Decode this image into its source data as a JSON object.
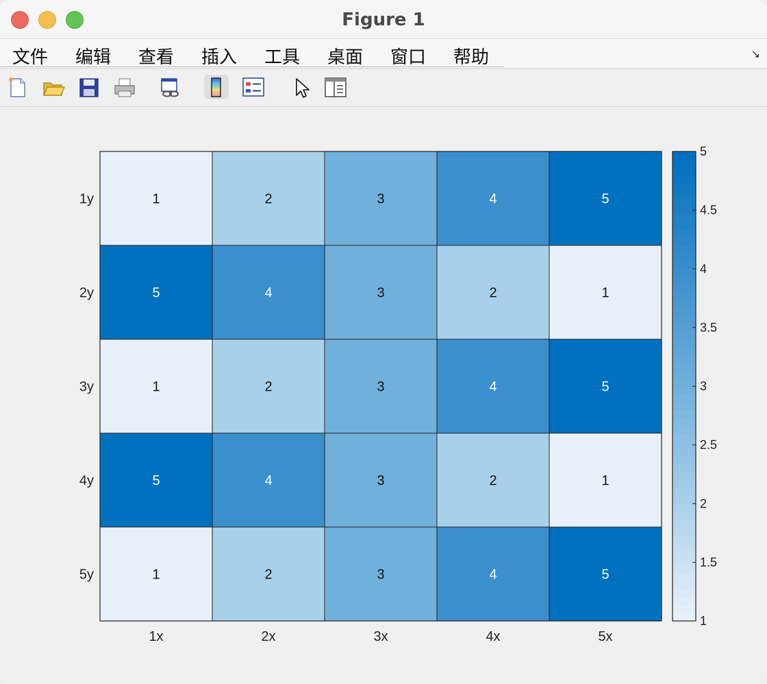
{
  "window": {
    "title": "Figure 1"
  },
  "menu": {
    "items": [
      "文件",
      "编辑",
      "查看",
      "插入",
      "工具",
      "桌面",
      "窗口",
      "帮助"
    ],
    "dock_glyph": "↘"
  },
  "toolbar": {
    "icons": [
      "new-figure-icon",
      "open-file-icon",
      "save-icon",
      "print-icon",
      "link-plot-icon",
      "colorbar-icon",
      "legend-icon",
      "pointer-icon",
      "property-inspector-icon"
    ]
  },
  "chart_data": {
    "type": "heatmap",
    "xlabels": [
      "1x",
      "2x",
      "3x",
      "4x",
      "5x"
    ],
    "ylabels": [
      "1y",
      "2y",
      "3y",
      "4y",
      "5y"
    ],
    "values": [
      [
        1,
        2,
        3,
        4,
        5
      ],
      [
        5,
        4,
        3,
        2,
        1
      ],
      [
        1,
        2,
        3,
        4,
        5
      ],
      [
        5,
        4,
        3,
        2,
        1
      ],
      [
        1,
        2,
        3,
        4,
        5
      ]
    ],
    "colormap": [
      "#e8f1f9",
      "#a9d0ea",
      "#71b0db",
      "#3a8fcc",
      "#0070bf"
    ],
    "colorbar": {
      "range": [
        1,
        5
      ],
      "ticks": [
        "1",
        "1.5",
        "2",
        "2.5",
        "3",
        "3.5",
        "4",
        "4.5",
        "5"
      ],
      "placement": "right"
    }
  }
}
